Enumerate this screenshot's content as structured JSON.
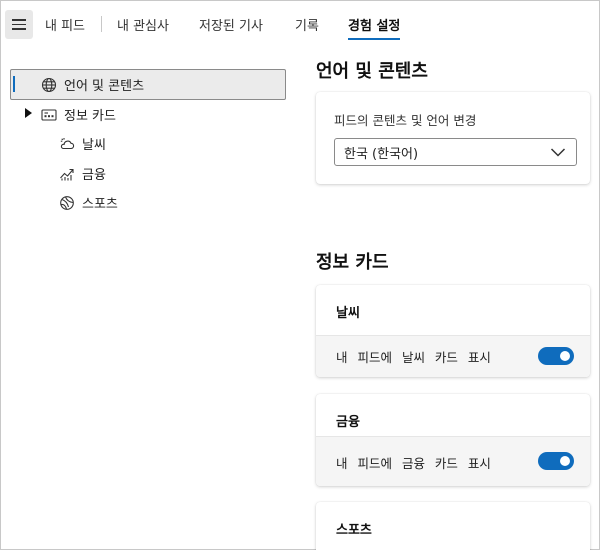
{
  "nav": {
    "tabs": [
      {
        "label": "내 피드"
      },
      {
        "label": "내 관심사"
      },
      {
        "label": "저장된 기사"
      },
      {
        "label": "기록"
      },
      {
        "label": "경험 설정",
        "active": true
      }
    ]
  },
  "sidebar": {
    "items": [
      {
        "label": "언어 및 콘텐츠",
        "icon": "globe-icon",
        "selected": true
      },
      {
        "label": "정보 카드",
        "icon": "card-icon",
        "expanded": true
      },
      {
        "label": "날씨",
        "icon": "weather-icon"
      },
      {
        "label": "금융",
        "icon": "finance-icon"
      },
      {
        "label": "스포츠",
        "icon": "sports-icon"
      }
    ]
  },
  "main": {
    "language_section": {
      "title": "언어 및 콘텐츠",
      "field_label": "피드의 콘텐츠 및 언어 변경",
      "selected_value": "한국 (한국어)"
    },
    "cards_section": {
      "title": "정보 카드",
      "cards": [
        {
          "title": "날씨",
          "toggle_text": "내 피드에 날씨 카드 표시",
          "enabled": true
        },
        {
          "title": "금융",
          "toggle_text": "내 피드에 금융 카드 표시",
          "enabled": true
        },
        {
          "title": "스포츠"
        }
      ]
    }
  },
  "colors": {
    "accent": "#0f6cbd",
    "selected_bg": "#ebebeb"
  }
}
